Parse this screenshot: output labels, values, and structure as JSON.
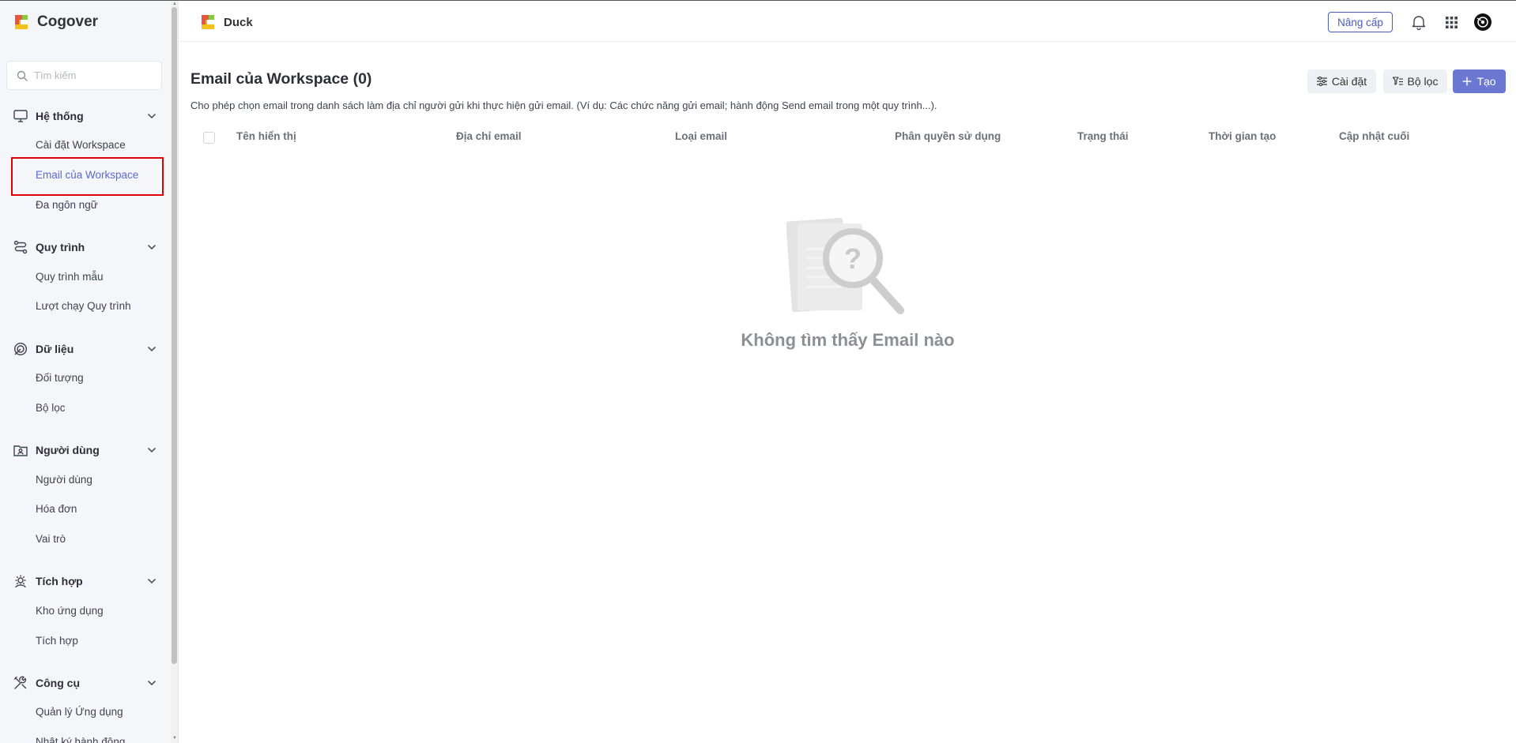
{
  "brand": {
    "name": "Cogover"
  },
  "workspace": {
    "name": "Duck"
  },
  "search": {
    "placeholder": "Tìm kiếm"
  },
  "header": {
    "upgrade_label": "Nâng cấp"
  },
  "sidebar": {
    "sections": [
      {
        "label": "Hệ thống",
        "icon": "monitor-icon",
        "items": [
          "Cài đặt Workspace",
          "Email của Workspace",
          "Đa ngôn ngữ"
        ]
      },
      {
        "label": "Quy trình",
        "icon": "workflow-icon",
        "items": [
          "Quy trình mẫu",
          "Lượt chạy Quy trình"
        ]
      },
      {
        "label": "Dữ liệu",
        "icon": "data-icon",
        "items": [
          "Đối tượng",
          "Bộ lọc"
        ]
      },
      {
        "label": "Người dùng",
        "icon": "user-icon",
        "items": [
          "Người dùng",
          "Hóa đơn",
          "Vai trò"
        ]
      },
      {
        "label": "Tích hợp",
        "icon": "integration-icon",
        "items": [
          "Kho ứng dụng",
          "Tích hợp"
        ]
      },
      {
        "label": "Công cụ",
        "icon": "tools-icon",
        "items": [
          "Quản lý Ứng dụng",
          "Nhật ký hành động"
        ]
      }
    ],
    "active_item": "Email của Workspace"
  },
  "main": {
    "title": "Email của Workspace (0)",
    "description": "Cho phép chọn email trong danh sách làm địa chỉ người gửi khi thực hiện gửi email. (Ví dụ: Các chức năng gửi email; hành động Send email trong một quy trình...).",
    "buttons": {
      "settings": "Cài đặt",
      "filter": "Bộ lọc",
      "create": "Tạo"
    },
    "columns": [
      "Tên hiển thị",
      "Địa chỉ email",
      "Loại email",
      "Phân quyền sử dụng",
      "Trạng thái",
      "Thời gian tạo",
      "Cập nhật cuối"
    ],
    "empty_message": "Không tìm thấy Email nào"
  },
  "colors": {
    "accent": "#6a78d1",
    "active_text": "#5b6acf",
    "highlight_frame": "#e00000",
    "sidebar_bg": "#f5f6fa"
  }
}
